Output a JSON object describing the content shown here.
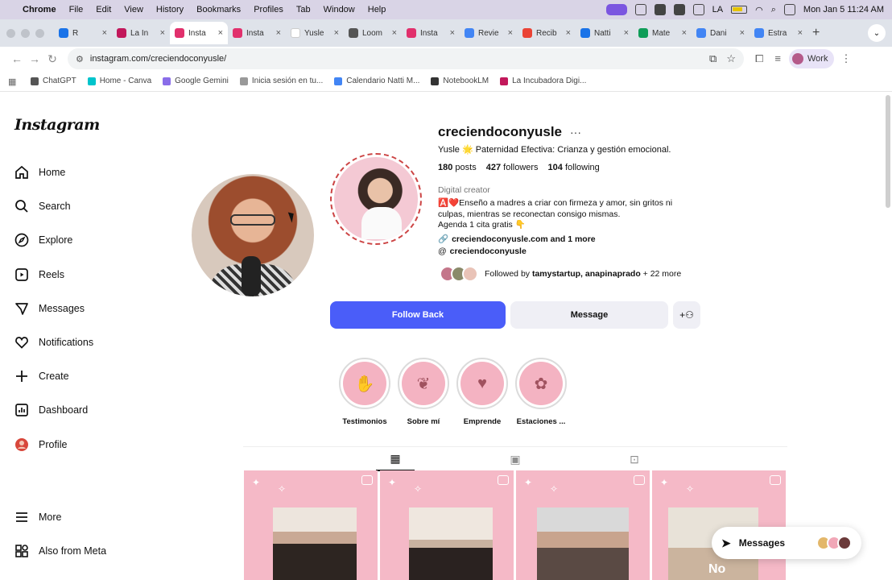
{
  "menubar": {
    "app": "Chrome",
    "items": [
      "File",
      "Edit",
      "View",
      "History",
      "Bookmarks",
      "Profiles",
      "Tab",
      "Window",
      "Help"
    ],
    "clock": "Mon Jan 5  11:24 AM",
    "input_source": "LA"
  },
  "tabs": [
    {
      "label": "R",
      "color": "#1a73e8"
    },
    {
      "label": "La In",
      "color": "#c2185b"
    },
    {
      "label": "Insta",
      "color": "#e1306c",
      "active": true
    },
    {
      "label": "Insta",
      "color": "#e1306c"
    },
    {
      "label": "Yusle",
      "color": "#ffffff"
    },
    {
      "label": "Loom",
      "color": "#555555"
    },
    {
      "label": "Insta",
      "color": "#e1306c"
    },
    {
      "label": "Revie",
      "color": "#4285f4"
    },
    {
      "label": "Recib",
      "color": "#ea4335"
    },
    {
      "label": "Natti",
      "color": "#1a73e8"
    },
    {
      "label": "Mate",
      "color": "#0f9d58"
    },
    {
      "label": "Dani",
      "color": "#4285f4"
    },
    {
      "label": "Estra",
      "color": "#4285f4"
    }
  ],
  "toolbar": {
    "url": "instagram.com/creciendoconyusle/",
    "profile_label": "Work"
  },
  "bookmarks": [
    {
      "label": "ChatGPT",
      "color": "#555555"
    },
    {
      "label": "Home - Canva",
      "color": "#00c4cc"
    },
    {
      "label": "Google Gemini",
      "color": "#8a6de9"
    },
    {
      "label": "Inicia sesión en tu...",
      "color": "#999999"
    },
    {
      "label": "Calendario Natti M...",
      "color": "#4285f4"
    },
    {
      "label": "NotebookLM",
      "color": "#333333"
    },
    {
      "label": "La Incubadora Digi...",
      "color": "#c2185b"
    }
  ],
  "instagram": {
    "logo": "Instagram",
    "nav": [
      {
        "label": "Home",
        "icon": "home-icon"
      },
      {
        "label": "Search",
        "icon": "search-icon"
      },
      {
        "label": "Explore",
        "icon": "explore-icon"
      },
      {
        "label": "Reels",
        "icon": "reels-icon"
      },
      {
        "label": "Messages",
        "icon": "messages-icon"
      },
      {
        "label": "Notifications",
        "icon": "heart-icon"
      },
      {
        "label": "Create",
        "icon": "plus-icon"
      },
      {
        "label": "Dashboard",
        "icon": "dashboard-icon"
      },
      {
        "label": "Profile",
        "icon": "profile-avatar-icon"
      }
    ],
    "more_label": "More",
    "meta_label": "Also from Meta",
    "profile": {
      "username": "creciendoconyusle",
      "bio_name": "Yusle 🌟 Paternidad Efectiva: Crianza y gestión emocional.",
      "posts_count": "180",
      "posts_label": "posts",
      "followers_count": "427",
      "followers_label": "followers",
      "following_count": "104",
      "following_label": "following",
      "category": "Digital creator",
      "bio_line1": "🅰️❤️Enseño a madres a criar con firmeza y amor, sin gritos ni culpas, mientras se reconectan consigo mismas.",
      "bio_line2": "Agenda 1 cita gratis 👇",
      "link": "creciendoconyusle.com and 1 more",
      "threads": "creciendoconyusle",
      "followed_by_prefix": "Followed by",
      "followed_by_names": "tamystartup, anapinaprado",
      "followed_by_suffix": "+ 22 more"
    },
    "buttons": {
      "follow_back": "Follow Back",
      "message": "Message"
    },
    "highlights": [
      "Testimonios",
      "Sobre mí",
      "Emprende",
      "Estaciones ..."
    ],
    "post_overlay_text": "No",
    "messages_pill": "Messages"
  }
}
